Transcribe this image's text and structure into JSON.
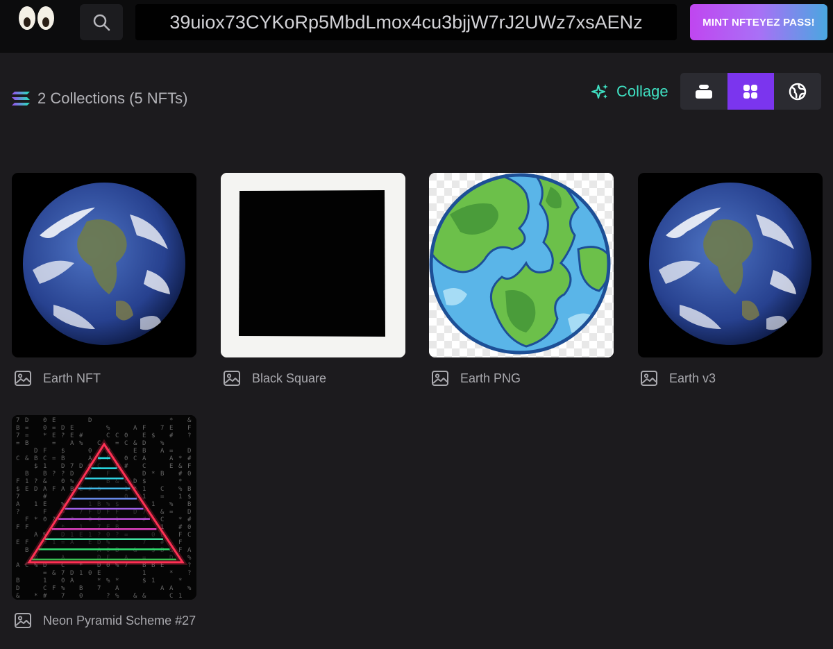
{
  "header": {
    "wallet_address": "39uiox73CYKoRp5MbdLmox4cu3bjjW7rJ2UWz7xsAENz",
    "mint_button_label": "MINT NFTEYEZ PASS!",
    "logo_icon": "eyes-logo",
    "search_icon": "search-icon"
  },
  "toolbar": {
    "collections_summary": "2 Collections (5 NFTs)",
    "collage_label": "Collage",
    "views": [
      {
        "icon": "stack-view-icon",
        "active": false
      },
      {
        "icon": "grid-view-icon",
        "active": true
      },
      {
        "icon": "globe-view-icon",
        "active": false
      }
    ]
  },
  "nfts": [
    {
      "name": "Earth NFT",
      "art": "earth-photo"
    },
    {
      "name": "Black Square",
      "art": "black-square"
    },
    {
      "name": "Earth PNG",
      "art": "earth-cartoon"
    },
    {
      "name": "Earth v3",
      "art": "earth-photo"
    },
    {
      "name": "Neon Pyramid Scheme #27",
      "art": "neon-pyramid"
    }
  ],
  "colors": {
    "background": "#1c1b1e",
    "topbar": "#0c0c0d",
    "accent_teal": "#3fe0c2",
    "active_view": "#7b35ee"
  }
}
